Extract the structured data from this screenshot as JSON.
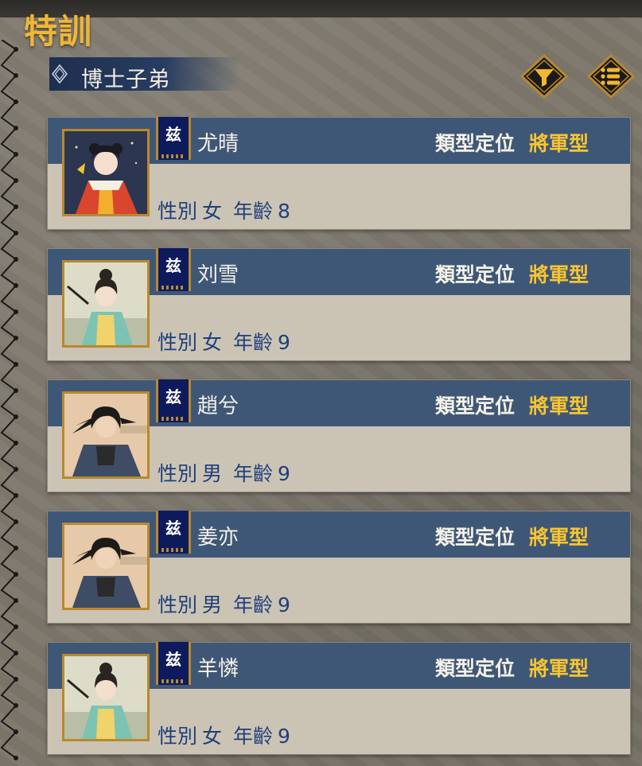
{
  "title": "特訓",
  "section_label": "博士子弟",
  "buttons": {
    "filter_icon": "filter-icon",
    "list_icon": "list-icon"
  },
  "colors": {
    "accent": "#f0b637",
    "band": "#3f5777",
    "type_value": "#f7c531",
    "info_text": "#1e3f7a"
  },
  "characters": [
    {
      "flag": "兹",
      "name": "尤晴",
      "type_label": "類型定位",
      "type_value": "將軍型",
      "gender_label": "性別",
      "gender": "女",
      "age_label": "年齡",
      "age": "8"
    },
    {
      "flag": "兹",
      "name": "刘雪",
      "type_label": "類型定位",
      "type_value": "將軍型",
      "gender_label": "性別",
      "gender": "女",
      "age_label": "年齡",
      "age": "9"
    },
    {
      "flag": "兹",
      "name": "趙兮",
      "type_label": "類型定位",
      "type_value": "將軍型",
      "gender_label": "性別",
      "gender": "男",
      "age_label": "年齡",
      "age": "9"
    },
    {
      "flag": "兹",
      "name": "姜亦",
      "type_label": "類型定位",
      "type_value": "將軍型",
      "gender_label": "性別",
      "gender": "男",
      "age_label": "年齡",
      "age": "9"
    },
    {
      "flag": "兹",
      "name": "羊憐",
      "type_label": "類型定位",
      "type_value": "將軍型",
      "gender_label": "性別",
      "gender": "女",
      "age_label": "年齡",
      "age": "9"
    }
  ]
}
